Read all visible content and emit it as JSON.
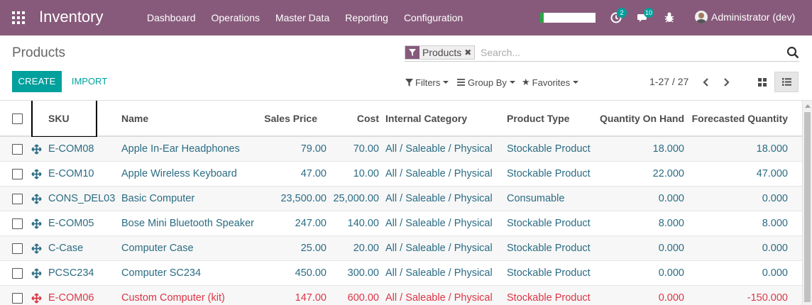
{
  "app": {
    "brand": "Inventory",
    "menu": [
      "Dashboard",
      "Operations",
      "Master Data",
      "Reporting",
      "Configuration"
    ],
    "activity_badge": "2",
    "messages_badge": "10",
    "user": "Administrator (dev)",
    "accent_color": "#875a7b"
  },
  "control": {
    "title": "Products",
    "facet_value": "Products",
    "search_placeholder": "Search...",
    "create_label": "CREATE",
    "import_label": "IMPORT",
    "filters_label": "Filters",
    "groupby_label": "Group By",
    "favorites_label": "Favorites",
    "pager": "1-27 / 27",
    "primary_color": "#00a09d"
  },
  "table": {
    "headers": {
      "sku": "SKU",
      "name": "Name",
      "sales_price": "Sales Price",
      "cost": "Cost",
      "category": "Internal Category",
      "type": "Product Type",
      "qty": "Quantity On Hand",
      "forecast": "Forecasted Quantity"
    },
    "rows": [
      {
        "sku": "E-COM08",
        "name": "Apple In-Ear Headphones",
        "price": "79.00",
        "cost": "70.00",
        "category": "All / Saleable / Physical",
        "type": "Stockable Product",
        "qty": "18.000",
        "forecast": "18.000"
      },
      {
        "sku": "E-COM10",
        "name": "Apple Wireless Keyboard",
        "price": "47.00",
        "cost": "10.00",
        "category": "All / Saleable / Physical",
        "type": "Stockable Product",
        "qty": "22.000",
        "forecast": "47.000"
      },
      {
        "sku": "CONS_DEL03",
        "name": "Basic Computer",
        "price": "23,500.00",
        "cost": "25,000.00",
        "category": "All / Saleable / Physical",
        "type": "Consumable",
        "qty": "0.000",
        "forecast": "0.000"
      },
      {
        "sku": "E-COM05",
        "name": "Bose Mini Bluetooth Speaker",
        "price": "247.00",
        "cost": "140.00",
        "category": "All / Saleable / Physical",
        "type": "Stockable Product",
        "qty": "8.000",
        "forecast": "8.000"
      },
      {
        "sku": "C-Case",
        "name": "Computer Case",
        "price": "25.00",
        "cost": "20.00",
        "category": "All / Saleable / Physical",
        "type": "Stockable Product",
        "qty": "0.000",
        "forecast": "0.000"
      },
      {
        "sku": "PCSC234",
        "name": "Computer SC234",
        "price": "450.00",
        "cost": "300.00",
        "category": "All / Saleable / Physical",
        "type": "Stockable Product",
        "qty": "0.000",
        "forecast": "0.000"
      },
      {
        "sku": "E-COM06",
        "name": "Custom Computer (kit)",
        "price": "147.00",
        "cost": "600.00",
        "category": "All / Saleable / Physical",
        "type": "Stockable Product",
        "qty": "0.000",
        "forecast": "-150.000"
      }
    ]
  }
}
